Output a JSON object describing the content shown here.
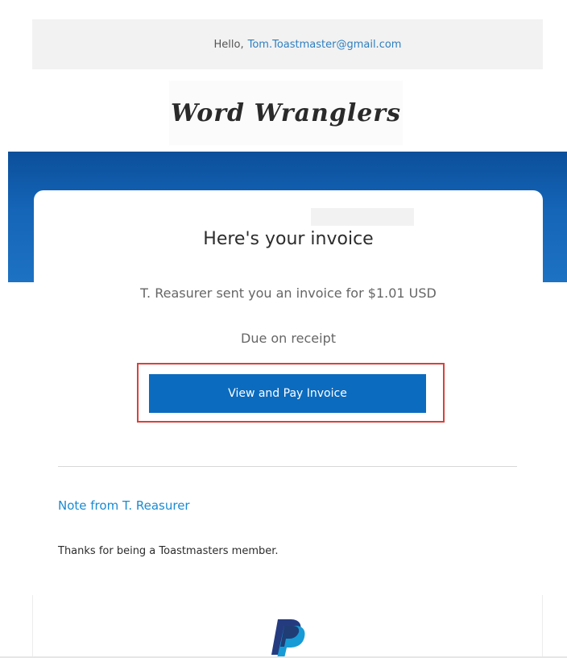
{
  "header": {
    "greeting_prefix": "Hello,",
    "email": "Tom.Toastmaster@gmail.com"
  },
  "brand": {
    "logo_text": "Word Wranglers"
  },
  "invoice": {
    "title": "Here's your invoice",
    "summary": "T. Reasurer sent you an invoice for $1.01 USD",
    "due": "Due on receipt",
    "button_label": "View and Pay Invoice"
  },
  "note": {
    "heading": "Note from T. Reasurer",
    "body": "Thanks for being a Toastmasters member."
  },
  "footer": {
    "logo_icon": "paypal-logo-icon"
  },
  "colors": {
    "accent_blue": "#0b6bbf",
    "link_blue": "#1a8ad1",
    "highlight_red": "#d9413b",
    "band_blue": "#1565b8"
  }
}
